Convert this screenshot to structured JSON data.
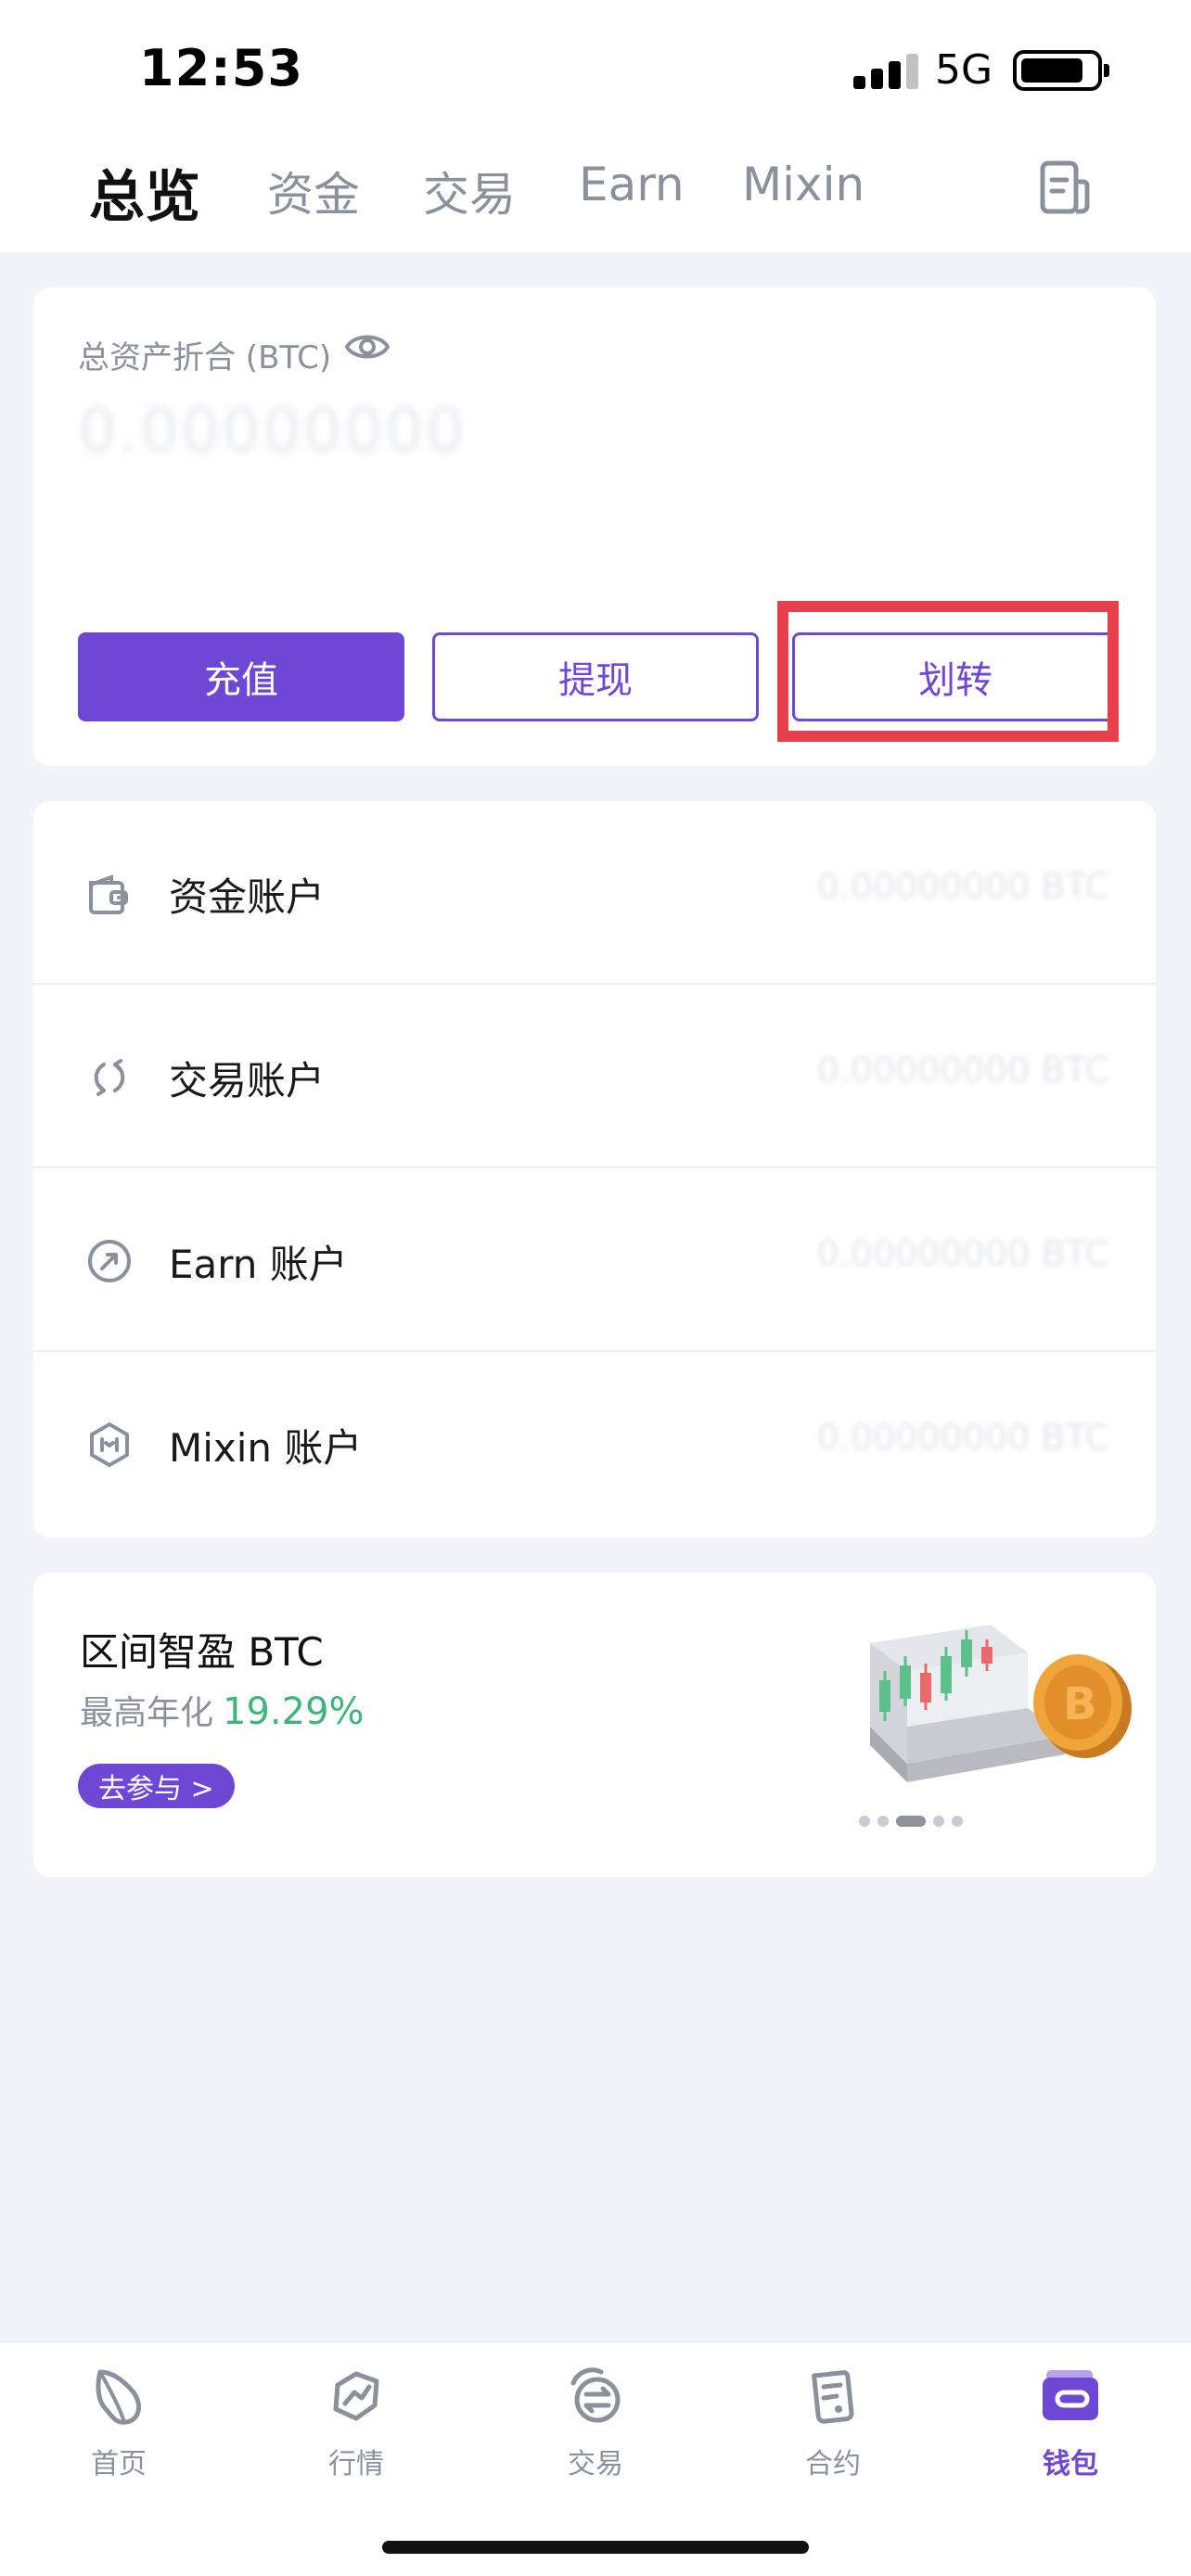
{
  "status_bar": {
    "time": "12:53",
    "network": "5G"
  },
  "top_tabs": [
    {
      "label": "总览",
      "active": true
    },
    {
      "label": "资金",
      "active": false
    },
    {
      "label": "交易",
      "active": false
    },
    {
      "label": "Earn",
      "active": false
    },
    {
      "label": "Mixin",
      "active": false
    }
  ],
  "asset_card": {
    "label": "总资产折合 (BTC)",
    "value": "0.00000000",
    "buttons": {
      "deposit": "充值",
      "withdraw": "提现",
      "transfer": "划转"
    }
  },
  "accounts": [
    {
      "label": "资金账户",
      "icon": "wallet-icon",
      "value": "0.00000000 BTC"
    },
    {
      "label": "交易账户",
      "icon": "sync-icon",
      "value": "0.00000000 BTC"
    },
    {
      "label": "Earn 账户",
      "icon": "earn-icon",
      "value": "0.00000000 BTC"
    },
    {
      "label": "Mixin 账户",
      "icon": "mixin-icon",
      "value": "0.00000000 BTC"
    }
  ],
  "promo": {
    "title": "区间智盈 BTC",
    "sub_label": "最高年化",
    "rate": "19.29%",
    "cta": "去参与 >",
    "carousel_index": 2,
    "carousel_count": 5
  },
  "bottom_nav": [
    {
      "label": "首页",
      "icon": "home-icon",
      "active": false
    },
    {
      "label": "行情",
      "icon": "market-icon",
      "active": false
    },
    {
      "label": "交易",
      "icon": "trade-icon",
      "active": false
    },
    {
      "label": "合约",
      "icon": "contract-icon",
      "active": false
    },
    {
      "label": "钱包",
      "icon": "wallet-icon",
      "active": true
    }
  ],
  "colors": {
    "accent": "#6e48d5",
    "highlight": "#e8404a",
    "positive": "#3db679"
  }
}
